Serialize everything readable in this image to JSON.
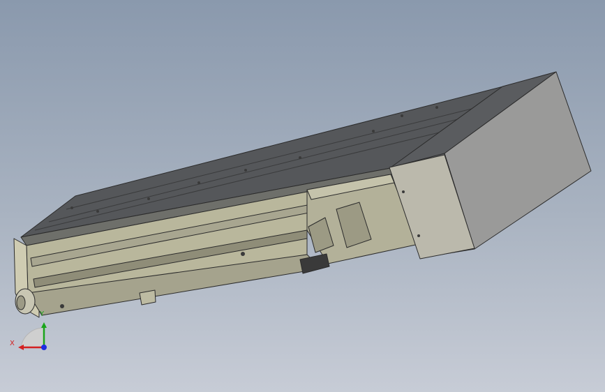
{
  "viewport": {
    "background_top": "#8a99ad",
    "background_bottom": "#c7ccd6"
  },
  "model": {
    "body_color": "#b9b79c",
    "top_color": "#55575a",
    "motor_color": "#67696c",
    "motor_side_color": "#9a9a99",
    "flange_color": "#bbb9ac",
    "edge_color": "#2b2b2b"
  },
  "triad": {
    "x_label": "X",
    "y_label": "Y",
    "x_color": "#d42020",
    "y_color": "#1aa51a",
    "z_color": "#1e2ee0"
  }
}
